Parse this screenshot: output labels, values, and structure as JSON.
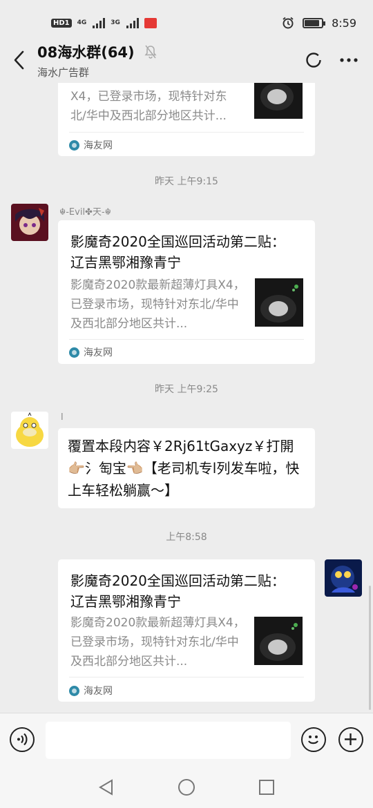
{
  "status_bar": {
    "hd_label": "HD",
    "hd_sub": "1",
    "net1": "4G",
    "net2": "3G",
    "time": "8:59"
  },
  "header": {
    "title": "08海水群(64)",
    "subtitle": "海水广告群"
  },
  "messages": {
    "card1": {
      "desc_lines": [
        "X4，已登录市场，现特针对东",
        "北/华中及西北部分地区共计..."
      ],
      "source": "海友网"
    },
    "time2": "昨天 上午9:15",
    "card2": {
      "nick": "☬-Evil✤天-☬",
      "title": "影魔奇2020全国巡回活动第二贴： 辽吉黑鄂湘豫青宁",
      "desc": "影魔奇2020款最新超薄灯具X4，已登录市场，现特针对东北/华中及西北部分地区共计...",
      "source": "海友网"
    },
    "time3": "昨天 上午9:25",
    "text1": {
      "nick": "l",
      "text": "覆置本段内容￥2Rj61tGaxyz￥打開👉🏼氵匋宝👈🏼【老司机专l列发车啦，快上车轻松躺赢～】"
    },
    "time4": "上午8:58",
    "card3": {
      "title": "影魔奇2020全国巡回活动第二贴： 辽吉黑鄂湘豫青宁",
      "desc": "影魔奇2020款最新超薄灯具X4，已登录市场，现特针对东北/华中及西北部分地区共计...",
      "source": "海友网"
    }
  },
  "icons": [
    "back-icon",
    "mute-bell-icon",
    "refresh-icon",
    "more-icon",
    "voice-icon",
    "emoji-icon",
    "plus-icon",
    "nav-back-icon",
    "nav-home-icon",
    "nav-recents-icon"
  ]
}
